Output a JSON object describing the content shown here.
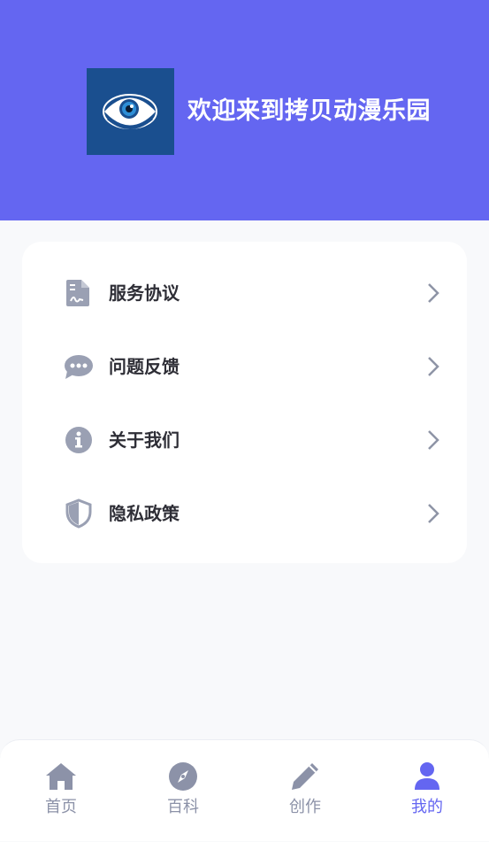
{
  "header": {
    "welcome": "欢迎来到拷贝动漫乐园",
    "background_color": "#6466f1",
    "logo_icon": "eye-logo-icon"
  },
  "menu": {
    "items": [
      {
        "label": "服务协议",
        "icon": "document-icon"
      },
      {
        "label": "问题反馈",
        "icon": "chat-bubble-icon"
      },
      {
        "label": "关于我们",
        "icon": "info-circle-icon"
      },
      {
        "label": "隐私政策",
        "icon": "shield-icon"
      }
    ]
  },
  "tabbar": {
    "active": "我的",
    "active_color": "#6466f1",
    "inactive_color": "#8c92a8",
    "tabs": [
      {
        "label": "首页",
        "icon": "home-icon"
      },
      {
        "label": "百科",
        "icon": "compass-icon"
      },
      {
        "label": "创作",
        "icon": "pencil-icon"
      },
      {
        "label": "我的",
        "icon": "user-icon"
      }
    ]
  }
}
